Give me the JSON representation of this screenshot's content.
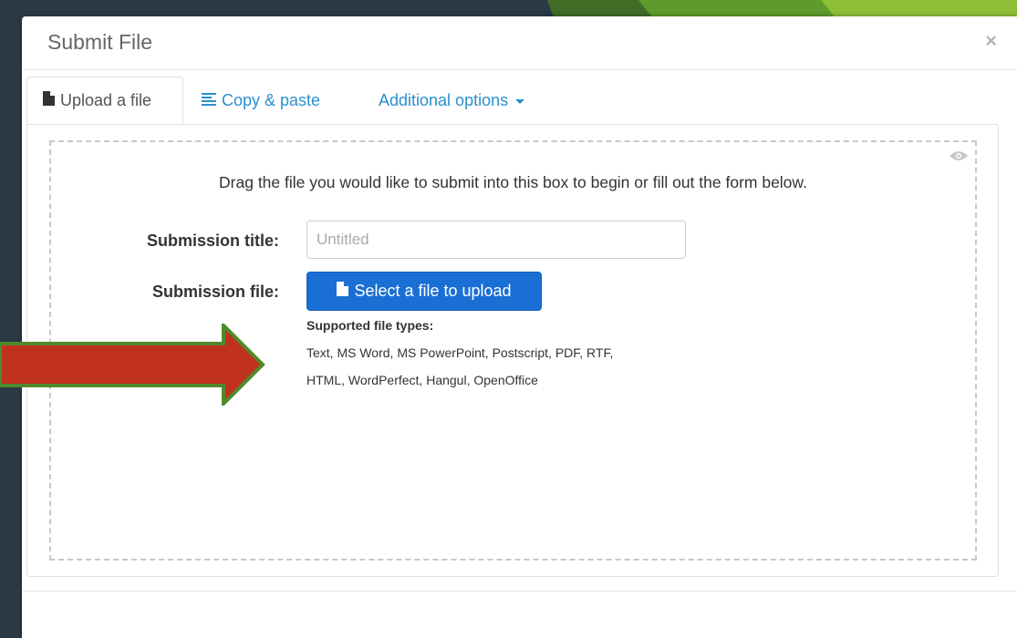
{
  "modal": {
    "title": "Submit File",
    "close_symbol": "×"
  },
  "tabs": [
    {
      "label": "Upload a file",
      "icon": "file-icon",
      "active": true
    },
    {
      "label": "Copy & paste",
      "icon": "align-left-icon",
      "active": false
    },
    {
      "label": "Additional options",
      "icon": "caret-down-icon",
      "active": false
    }
  ],
  "dropzone": {
    "instruction": "Drag the file you would like to submit into this box to begin or fill out the form below.",
    "icon": "eye-icon"
  },
  "form": {
    "title_label": "Submission title:",
    "title_placeholder": "Untitled",
    "title_value": "",
    "file_label": "Submission file:",
    "upload_button_label": "Select a file to upload",
    "supported_heading": "Supported file types:",
    "supported_line_1": "Text, MS Word, MS PowerPoint, Postscript, PDF, RTF,",
    "supported_line_2": "HTML, WordPerfect, Hangul, OpenOffice"
  },
  "colors": {
    "accent_blue": "#1a6fd4",
    "link_blue": "#2a8fcf",
    "arrow_red": "#c1311f",
    "arrow_outline": "#4f8a2a",
    "slide_bg": "#2b3a45",
    "slide_green": "#6aa22a"
  }
}
